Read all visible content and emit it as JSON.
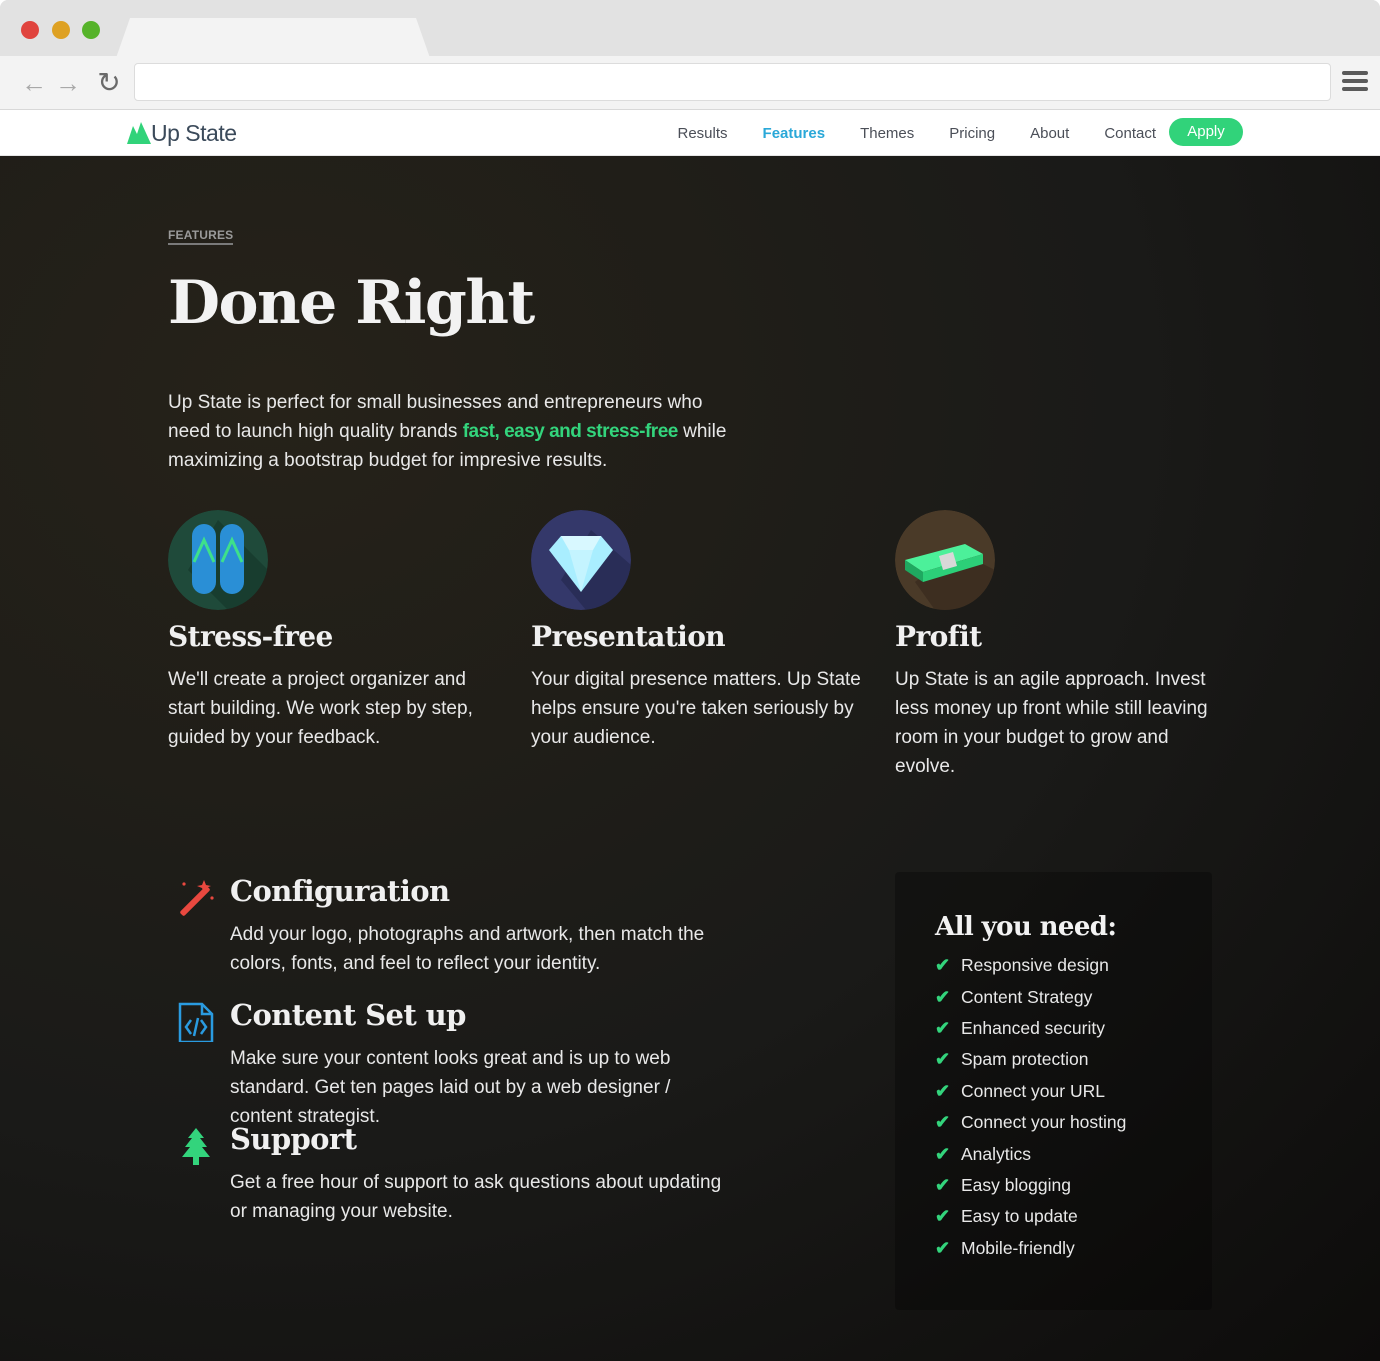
{
  "browser": {
    "address_value": ""
  },
  "site": {
    "logo_text": "Up State",
    "nav": [
      "Results",
      "Features",
      "Themes",
      "Pricing",
      "About",
      "Contact"
    ],
    "active_nav": "Features",
    "apply_label": "Apply",
    "accent_color": "#31d37a",
    "link_color": "#2aa8d8"
  },
  "hero": {
    "eyebrow": "FEATURES",
    "title": "Done Right",
    "intro_before": "Up State is perfect for small businesses and entrepreneurs who need to launch high quality brands ",
    "intro_highlight": "fast, easy and stress-free",
    "intro_after": " while maximizing a bootstrap budget for impresive results."
  },
  "features": [
    {
      "icon": "flip-flops-icon",
      "title": "Stress-free",
      "text": "We'll create a project organizer and start building. We work step by step, guided by your feedback."
    },
    {
      "icon": "diamond-icon",
      "title": "Presentation",
      "text": "Your digital presence matters. Up State helps ensure you're taken seriously by your audience."
    },
    {
      "icon": "money-stack-icon",
      "title": "Profit",
      "text": "Up State is an agile approach. Invest less money up front while still leaving room in your budget to grow and evolve."
    }
  ],
  "details": [
    {
      "icon": "magic-wand-icon",
      "title": "Configuration",
      "text": "Add your logo, photographs and artwork, then match the colors, fonts, and feel to reflect your identity."
    },
    {
      "icon": "code-file-icon",
      "title": "Content Set up",
      "text": "Make sure your content looks great and is up to web standard. Get ten pages laid out by a web designer / content strategist."
    },
    {
      "icon": "tree-icon",
      "title": "Support",
      "text": "Get a free hour of support to ask questions about updating or managing your website."
    }
  ],
  "needs": {
    "title": "All you need:",
    "items": [
      "Responsive design",
      "Content Strategy",
      "Enhanced security",
      "Spam protection",
      "Connect your URL",
      "Connect your hosting",
      "Analytics",
      "Easy blogging",
      "Easy to update",
      "Mobile-friendly"
    ]
  }
}
